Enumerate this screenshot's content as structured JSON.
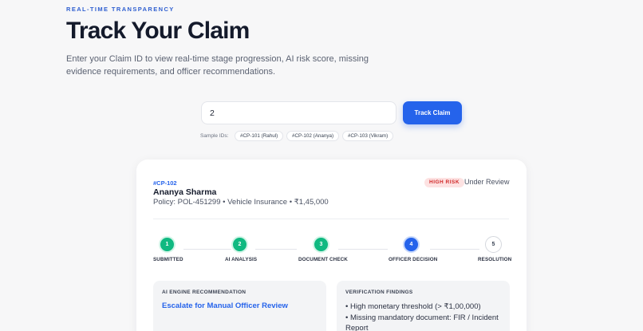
{
  "header": {
    "eyebrow": "REAL-TIME TRANSPARENCY",
    "title": "Track Your Claim",
    "subtitle": "Enter your Claim ID to view real-time stage progression, AI risk score, missing evidence requirements, and officer recommendations."
  },
  "search": {
    "value": "2",
    "button_label": "Track Claim",
    "samples_label": "Sample IDs:",
    "samples": [
      "#CP-101 (Rahul)",
      "#CP-102 (Ananya)",
      "#CP-103 (Vikram)"
    ]
  },
  "claim": {
    "id": "#CP-102",
    "name": "Ananya Sharma",
    "policy_line": "Policy: POL-451299 • Vehicle Insurance • ₹1,45,000",
    "risk_badge": "HIGH RISK",
    "status": "Under Review"
  },
  "progress": {
    "steps": [
      {
        "number": "1",
        "label": "SUBMITTED",
        "state": "done"
      },
      {
        "number": "2",
        "label": "AI ANALYSIS",
        "state": "done"
      },
      {
        "number": "3",
        "label": "DOCUMENT CHECK",
        "state": "done"
      },
      {
        "number": "4",
        "label": "OFFICER DECISION",
        "state": "active"
      },
      {
        "number": "5",
        "label": "RESOLUTION",
        "state": "pending"
      }
    ]
  },
  "ai_panel": {
    "title": "AI ENGINE RECOMMENDATION",
    "recommendation": "Escalate for Manual Officer Review"
  },
  "verification": {
    "title": "VERIFICATION FINDINGS",
    "items": [
      "High monetary threshold (> ₹1,00,000)",
      "Missing mandatory document: FIR / Incident Report"
    ]
  },
  "colors": {
    "accent": "#2563eb",
    "done": "#10b981",
    "risk": "#d12a2a"
  }
}
